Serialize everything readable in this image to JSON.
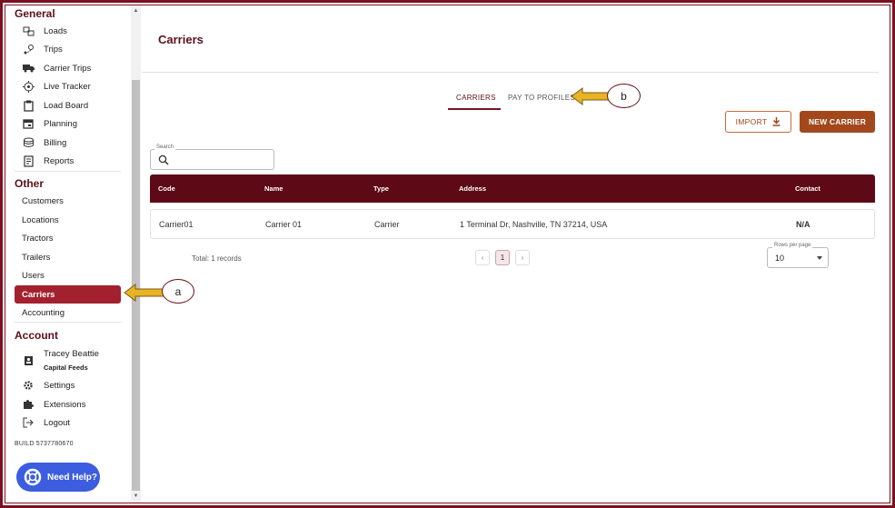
{
  "sidebar": {
    "general_title": "General",
    "general_items": [
      {
        "label": "Loads",
        "icon": "boxes-icon"
      },
      {
        "label": "Trips",
        "icon": "route-icon"
      },
      {
        "label": "Carrier Trips",
        "icon": "truck-icon"
      },
      {
        "label": "Live Tracker",
        "icon": "crosshair-icon"
      },
      {
        "label": "Load Board",
        "icon": "clipboard-icon"
      },
      {
        "label": "Planning",
        "icon": "calendar-icon"
      },
      {
        "label": "Billing",
        "icon": "coins-icon"
      },
      {
        "label": "Reports",
        "icon": "document-icon"
      }
    ],
    "other_title": "Other",
    "other_items": [
      {
        "label": "Customers"
      },
      {
        "label": "Locations"
      },
      {
        "label": "Tractors"
      },
      {
        "label": "Trailers"
      },
      {
        "label": "Users"
      },
      {
        "label": "Carriers"
      },
      {
        "label": "Accounting"
      }
    ],
    "active_item": "Carriers",
    "account_title": "Account",
    "user_name": "Tracey Beattie",
    "user_company": "Capital Feeds",
    "account_items": [
      {
        "label": "Settings",
        "icon": "gear-icon"
      },
      {
        "label": "Extensions",
        "icon": "puzzle-icon"
      },
      {
        "label": "Logout",
        "icon": "logout-icon"
      }
    ],
    "build": "BUILD 5737780670",
    "help_label": "Need Help?"
  },
  "page": {
    "title": "Carriers",
    "tabs": [
      {
        "label": "CARRIERS",
        "active": true
      },
      {
        "label": "PAY TO PROFILES",
        "active": false
      }
    ],
    "import_label": "IMPORT",
    "new_label": "NEW CARRIER",
    "search_label": "Search",
    "search_value": ""
  },
  "table": {
    "columns": [
      "Code",
      "Name",
      "Type",
      "Address",
      "Contact"
    ],
    "rows": [
      [
        "Carrier01",
        "Carrier 01",
        "Carrier",
        "1 Terminal Dr, Nashville, TN 37214, USA",
        "N/A"
      ]
    ],
    "total": "Total: 1 records",
    "current_page": "1",
    "rows_per_page_label": "Rows per page",
    "rows_per_page": "10"
  },
  "callouts": {
    "a": "a",
    "b": "b"
  },
  "colors": {
    "brand": "#5e0a16",
    "active": "#a3212f",
    "accent": "#a3481c",
    "help": "#3c5de0",
    "callout_arrow": "#e8b423"
  }
}
